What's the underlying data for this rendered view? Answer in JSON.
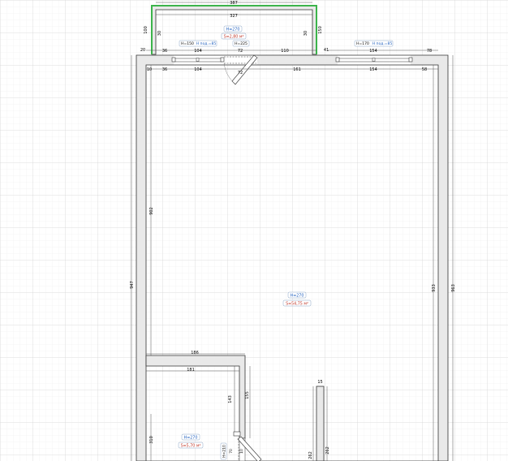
{
  "colors": {
    "background": "#ffffff",
    "grid_minor": "#ececec",
    "grid_major": "#d6d6d6",
    "wall_fill": "#e9e9e9",
    "wall_stroke": "#333333",
    "balcony_outline": "#3cb44b",
    "dimension_text": "#111111",
    "height_tag_text": "#1f5fbf",
    "area_tag_text": "#c0392b",
    "tag_border": "#8fa8c8"
  },
  "balcony": {
    "outer_width": "387",
    "inner_width": "327",
    "depth_left": "100",
    "depth_right": "150",
    "wall_left": "30",
    "wall_right": "30",
    "side_left": "20",
    "side_right": "41",
    "height_tag": "H=270",
    "area_tag": "S=2,80 м²"
  },
  "top_wall": {
    "dims_outer": [
      "36",
      "104",
      "72",
      "110"
    ],
    "dims_right": [
      "154",
      "78"
    ],
    "dims_inner": [
      "10",
      "36",
      "104",
      "72",
      "161",
      "154",
      "58"
    ],
    "window_left_h": "H=150",
    "window_left_sill": "H под.=85",
    "door_h": "H=225",
    "window_right_h": "H=170",
    "window_right_sill": "H под.=85"
  },
  "main_room": {
    "height_tag": "H=270",
    "area_tag": "S=54,75 м²",
    "dim_left_outer": "947",
    "dim_left_inner": "902",
    "dim_right_inner": "933",
    "dim_right_outer": "963"
  },
  "bathroom": {
    "dim_top_outer": "186",
    "dim_top_inner": "181",
    "dim_wall_inner": "143",
    "dim_wall_outer": "155",
    "dim_left": "310",
    "door_h": "H=210",
    "door_width": "70",
    "door_offset": "10",
    "height_tag": "H=270",
    "area_tag": "S=5,70 м²"
  },
  "partition": {
    "thickness": "15",
    "length_left": "262",
    "length_right": "262"
  }
}
